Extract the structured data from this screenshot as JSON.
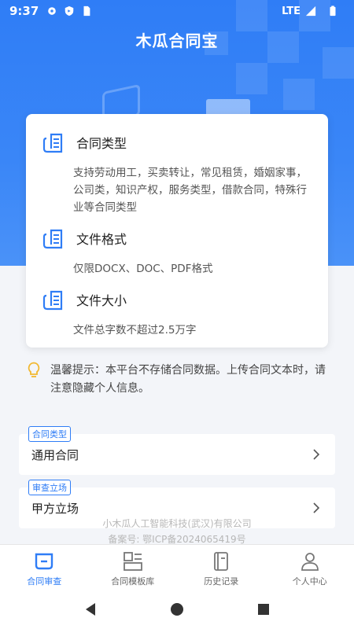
{
  "status_bar": {
    "time": "9:37",
    "network": "LTE"
  },
  "header": {
    "title": "木瓜合同宝"
  },
  "info_card": {
    "sections": [
      {
        "title": "合同类型",
        "desc": "支持劳动用工，买卖转让，常见租赁，婚姻家事，公司类，知识产权，服务类型，借款合同，特殊行业等合同类型"
      },
      {
        "title": "文件格式",
        "desc": "仅限DOCX、DOC、PDF格式"
      },
      {
        "title": "文件大小",
        "desc": "文件总字数不超过2.5万字"
      }
    ]
  },
  "tip": {
    "text": "温馨提示：本平台不存储合同数据。上传合同文本时，请注意隐藏个人信息。"
  },
  "contract_type": {
    "tag": "合同类型",
    "value": "通用合同"
  },
  "review_stance": {
    "tag": "审查立场",
    "value": "甲方立场"
  },
  "footer": {
    "company": "小木瓜人工智能科技(武汉)有限公司",
    "icp": "备案号: 鄂ICP备2024065419号"
  },
  "tabs": [
    {
      "label": "合同审查",
      "icon": "contract-review-icon",
      "active": true
    },
    {
      "label": "合同模板库",
      "icon": "template-library-icon",
      "active": false
    },
    {
      "label": "历史记录",
      "icon": "history-icon",
      "active": false
    },
    {
      "label": "个人中心",
      "icon": "profile-icon",
      "active": false
    }
  ],
  "colors": {
    "primary": "#2f7df6",
    "tip_icon": "#f2b830"
  }
}
